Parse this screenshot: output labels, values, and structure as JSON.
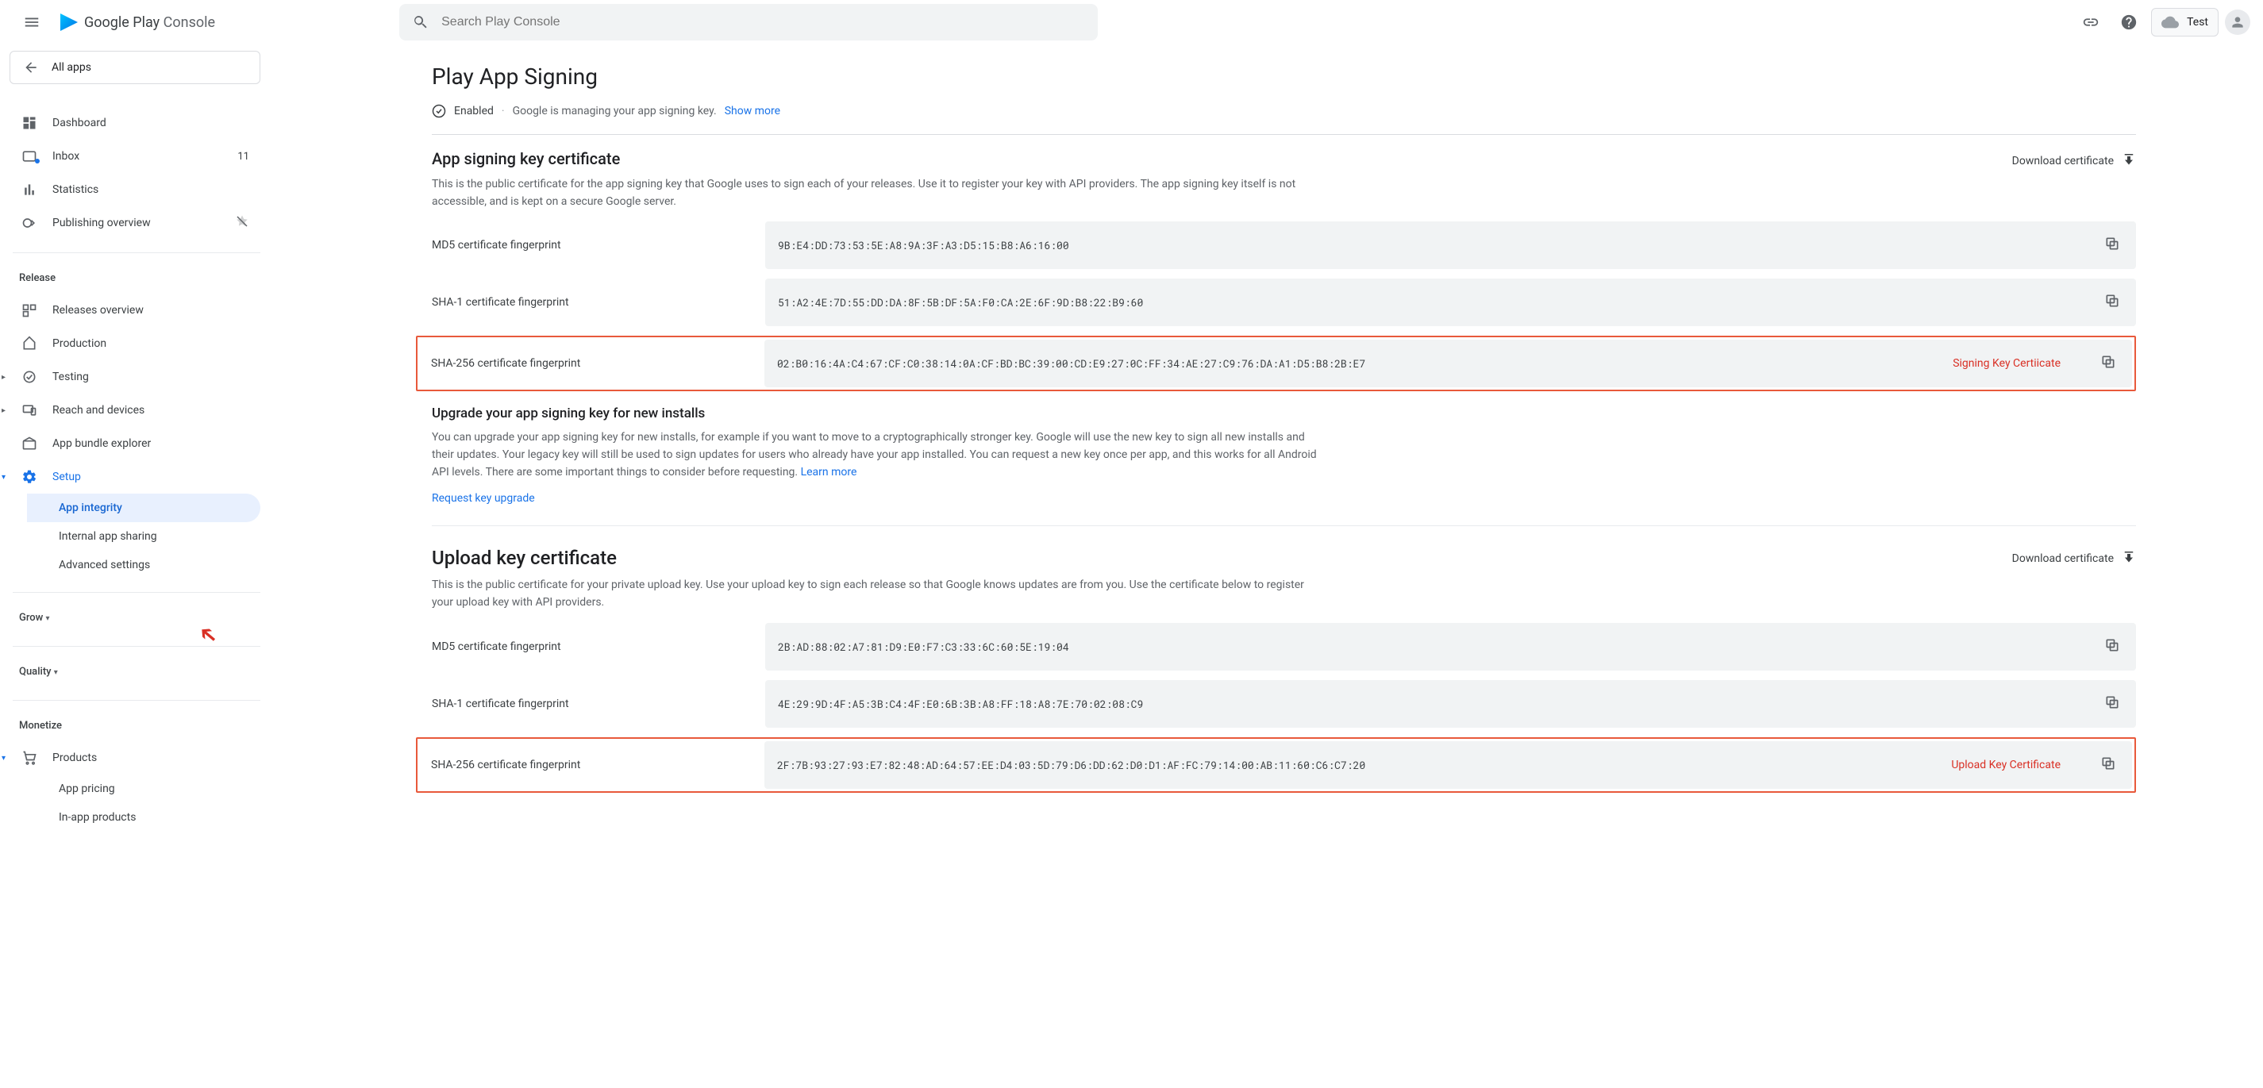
{
  "header": {
    "brand_dark": "Google Play",
    "brand_light": " Console",
    "search_placeholder": "Search Play Console",
    "account_label": "Test"
  },
  "sidebar": {
    "allapps": "All apps",
    "top": [
      {
        "label": "Dashboard"
      },
      {
        "label": "Inbox",
        "badge": "11"
      },
      {
        "label": "Statistics"
      },
      {
        "label": "Publishing overview"
      }
    ],
    "release_title": "Release",
    "release": [
      {
        "label": "Releases overview"
      },
      {
        "label": "Production"
      },
      {
        "label": "Testing"
      },
      {
        "label": "Reach and devices"
      },
      {
        "label": "App bundle explorer"
      },
      {
        "label": "Setup"
      }
    ],
    "setup_children": [
      {
        "label": "App integrity"
      },
      {
        "label": "Internal app sharing"
      },
      {
        "label": "Advanced settings"
      }
    ],
    "grow_title": "Grow",
    "quality_title": "Quality",
    "monetize_title": "Monetize",
    "monetize": [
      {
        "label": "Products"
      }
    ],
    "products_children": [
      {
        "label": "App pricing"
      },
      {
        "label": "In-app products"
      }
    ]
  },
  "page": {
    "title": "Play App Signing",
    "status_enabled": "Enabled",
    "status_desc": "Google is managing your app signing key.",
    "show_more": "Show more",
    "signing_section": {
      "title": "App signing key certificate",
      "desc": "This is the public certificate for the app signing key that Google uses to sign each of your releases. Use it to register your key with API providers. The app signing key itself is not accessible, and is kept on a secure Google server.",
      "download": "Download certificate",
      "fp": [
        {
          "label": "MD5 certificate fingerprint",
          "value": "9B:E4:DD:73:53:5E:A8:9A:3F:A3:D5:15:B8:A6:16:00"
        },
        {
          "label": "SHA-1 certificate fingerprint",
          "value": "51:A2:4E:7D:55:DD:DA:8F:5B:DF:5A:F0:CA:2E:6F:9D:B8:22:B9:60"
        },
        {
          "label": "SHA-256 certificate fingerprint",
          "value": "02:B0:16:4A:C4:67:CF:C0:38:14:0A:CF:BD:BC:39:00:CD:E9:27:0C:FF:34:AE:27:C9:76:DA:A1:D5:B8:2B:E7"
        }
      ],
      "annotation": "Signing Key Certiicate"
    },
    "upgrade_section": {
      "title": "Upgrade your app signing key for new installs",
      "desc": "You can upgrade your app signing key for new installs, for example if you want to move to a cryptographically stronger key. Google will use the new key to sign all new installs and their updates. Your legacy key will still be used to sign updates for users who already have your app installed. You can request a new key once per app, and this works for all Android API levels. There are some important things to consider before requesting.",
      "learn_more": "Learn more",
      "request": "Request key upgrade"
    },
    "upload_section": {
      "title": "Upload key certificate",
      "desc": "This is the public certificate for your private upload key. Use your upload key to sign each release so that Google knows updates are from you. Use the certificate below to register your upload key with API providers.",
      "download": "Download certificate",
      "fp": [
        {
          "label": "MD5 certificate fingerprint",
          "value": "2B:AD:88:02:A7:81:D9:E0:F7:C3:33:6C:60:5E:19:04"
        },
        {
          "label": "SHA-1 certificate fingerprint",
          "value": "4E:29:9D:4F:A5:3B:C4:4F:E0:6B:3B:A8:FF:18:A8:7E:70:02:08:C9"
        },
        {
          "label": "SHA-256 certificate fingerprint",
          "value": "2F:7B:93:27:93:E7:82:48:AD:64:57:EE:D4:03:5D:79:D6:DD:62:D0:D1:AF:FC:79:14:00:AB:11:60:C6:C7:20"
        }
      ],
      "annotation": "Upload Key Certificate"
    }
  }
}
